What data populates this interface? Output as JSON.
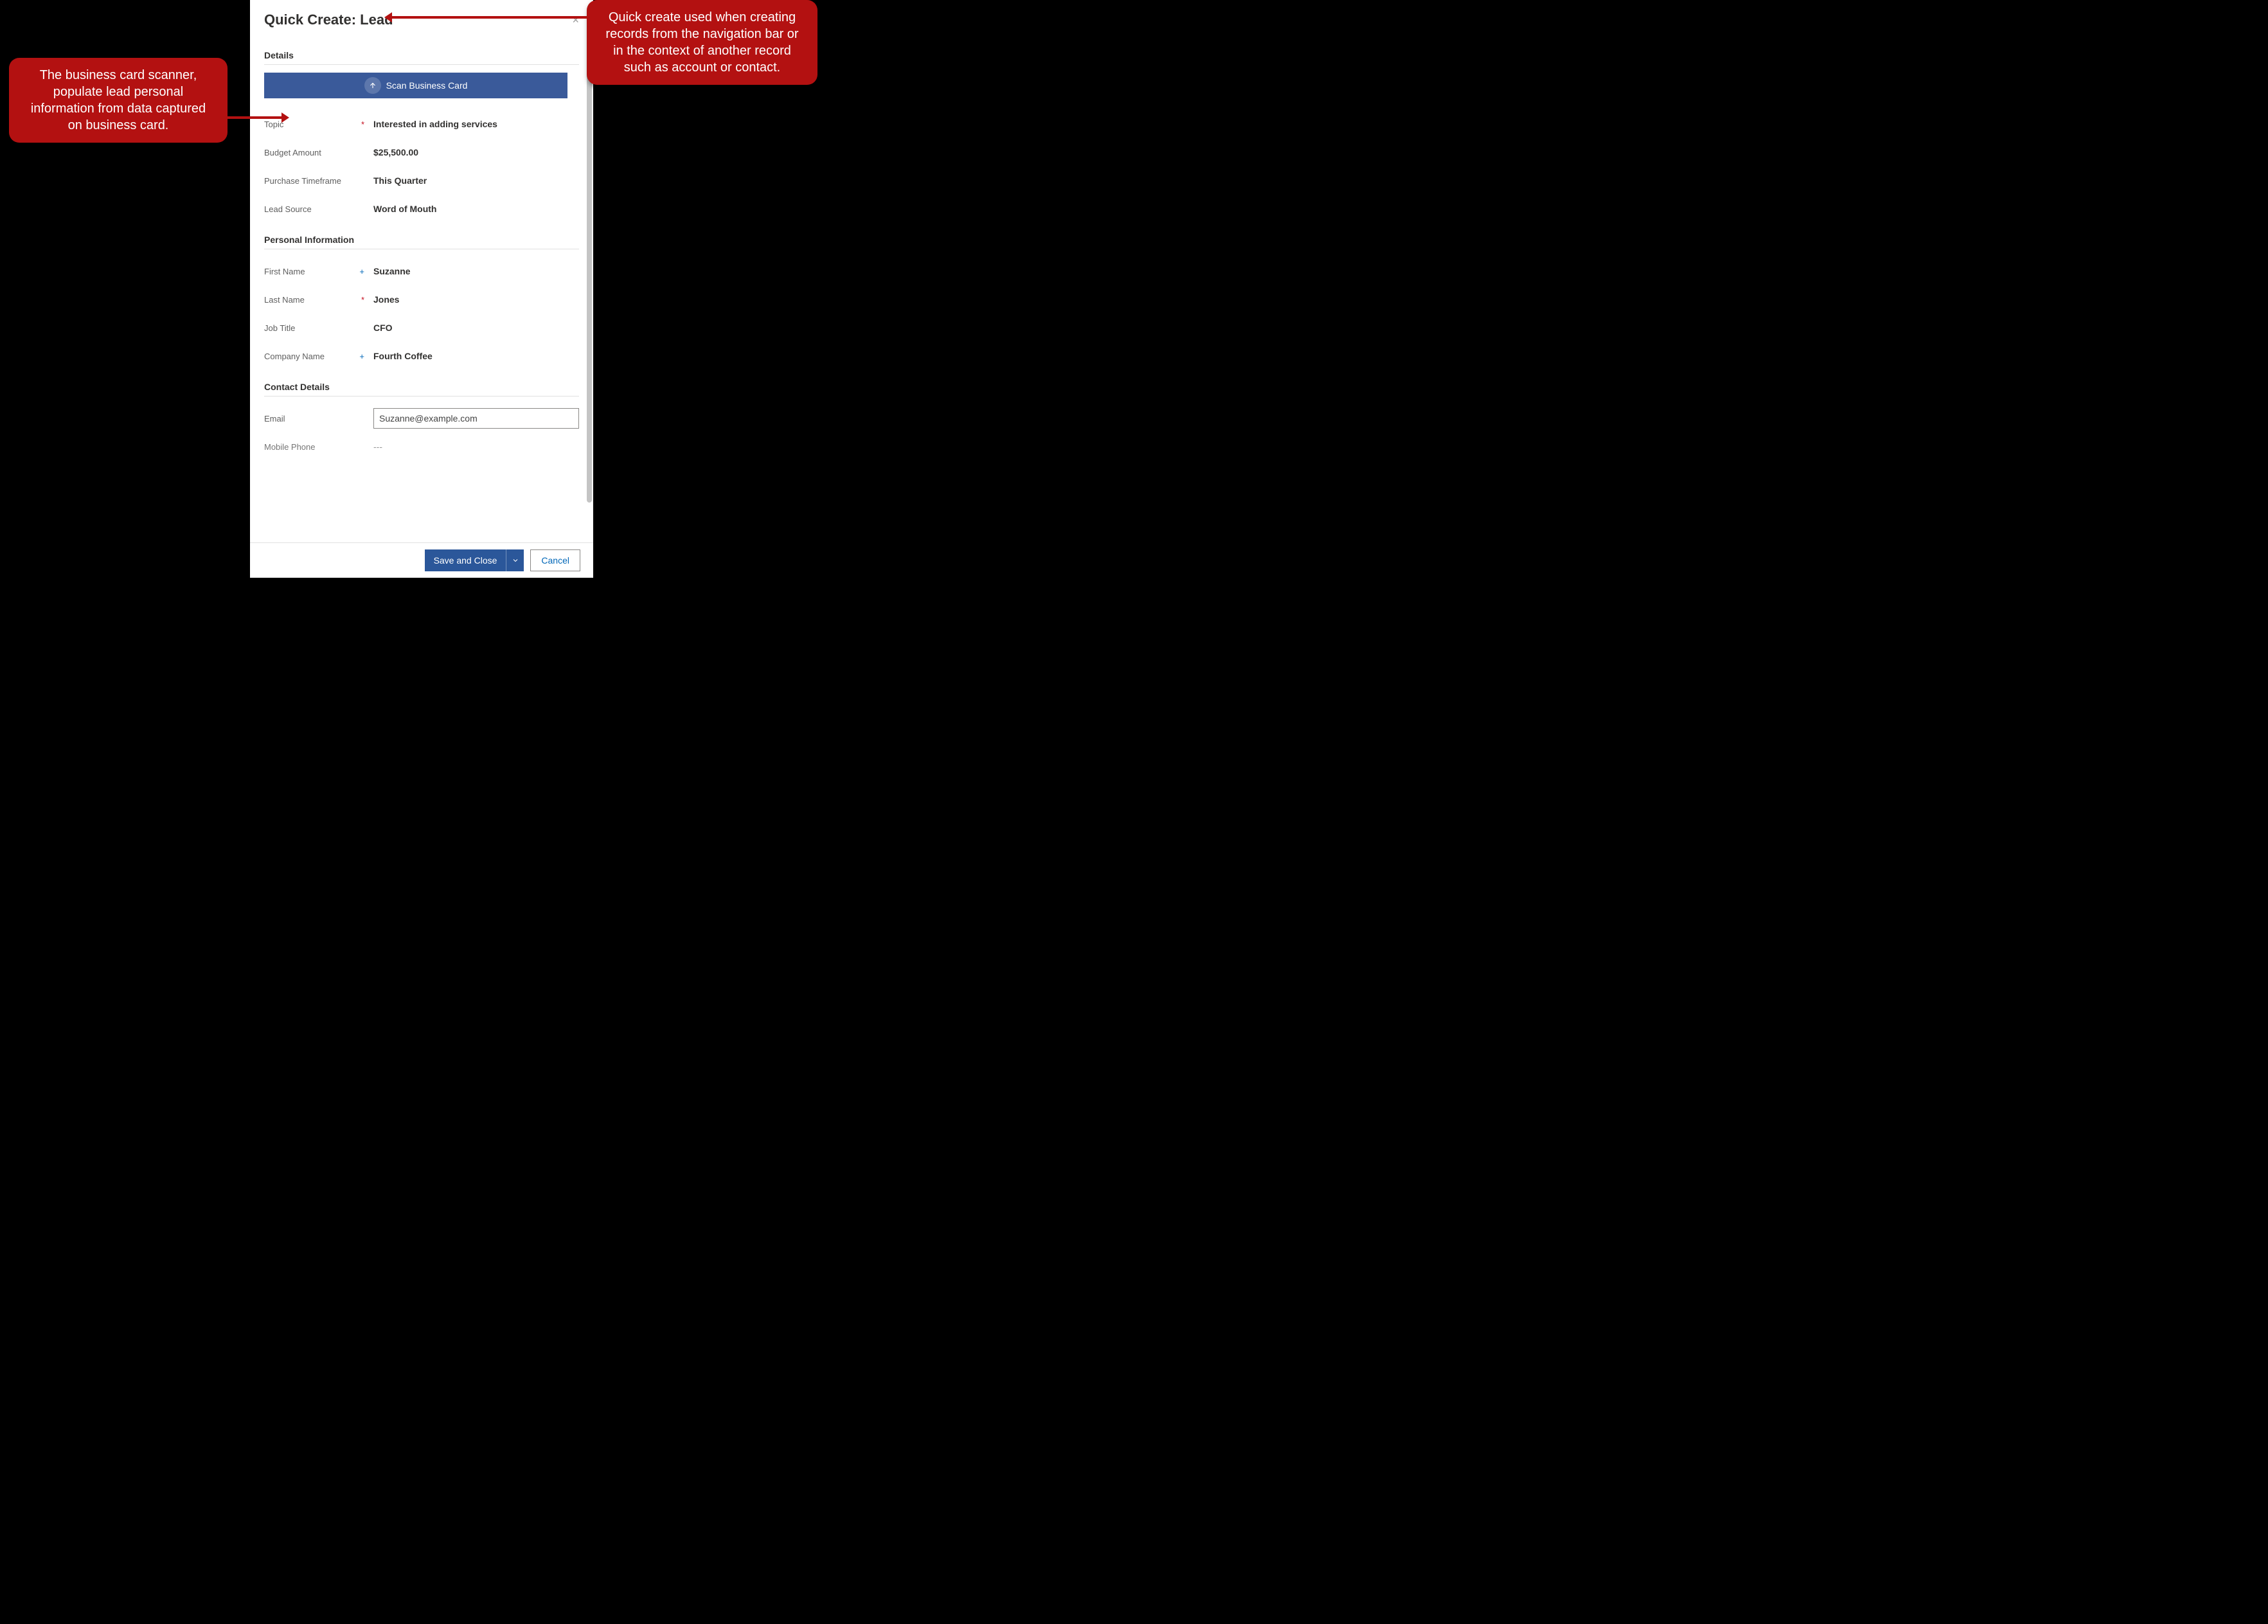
{
  "header": {
    "title": "Quick Create: Lead",
    "close_icon": "×"
  },
  "scan_button": "Scan Business Card",
  "sections": {
    "details": {
      "title": "Details",
      "fields": {
        "topic": {
          "label": "Topic",
          "mark": "*",
          "value": "Interested in adding services"
        },
        "budget": {
          "label": "Budget Amount",
          "mark": "",
          "value": "$25,500.00"
        },
        "timeframe": {
          "label": "Purchase Timeframe",
          "mark": "",
          "value": "This Quarter"
        },
        "lead_source": {
          "label": "Lead Source",
          "mark": "",
          "value": "Word of Mouth"
        }
      }
    },
    "personal": {
      "title": "Personal Information",
      "fields": {
        "first_name": {
          "label": "First Name",
          "mark": "+",
          "value": "Suzanne"
        },
        "last_name": {
          "label": "Last Name",
          "mark": "*",
          "value": "Jones"
        },
        "job_title": {
          "label": "Job Title",
          "mark": "",
          "value": "CFO"
        },
        "company": {
          "label": "Company Name",
          "mark": "+",
          "value": "Fourth Coffee"
        }
      }
    },
    "contact": {
      "title": "Contact Details",
      "fields": {
        "email": {
          "label": "Email",
          "mark": "",
          "value": "Suzanne@example.com"
        },
        "mobile_phone": {
          "label": "Mobile Phone",
          "mark": "",
          "value": "---"
        }
      }
    }
  },
  "footer": {
    "save": "Save and Close",
    "cancel": "Cancel"
  },
  "callouts": {
    "left": "The business card scanner, populate lead personal information from data captured on business card.",
    "right": "Quick create used when creating records from the navigation bar or in the context of another record such as account or contact."
  }
}
